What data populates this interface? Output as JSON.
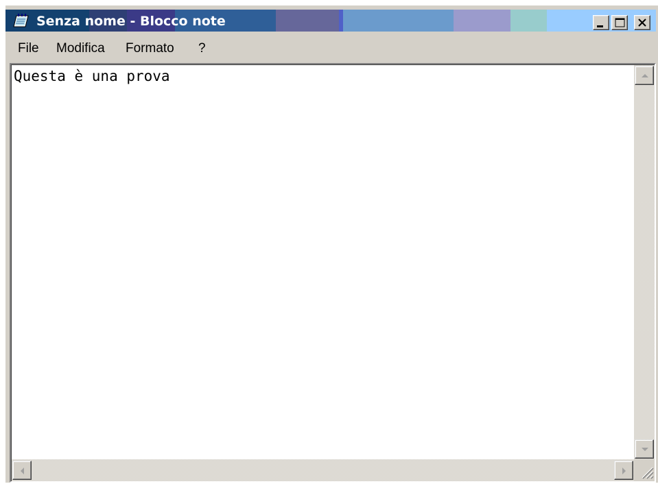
{
  "window": {
    "title": "Senza nome - Blocco note",
    "icon": "notepad-icon",
    "caption_buttons": [
      "minimize-icon",
      "maximize-icon",
      "close-icon"
    ]
  },
  "menu": {
    "items": [
      {
        "label": "File"
      },
      {
        "label": "Modifica"
      },
      {
        "label": "Formato"
      },
      {
        "label": "?"
      }
    ]
  },
  "editor": {
    "content": "Questa è una prova"
  },
  "scrollbars": {
    "vertical": [
      "scroll-up-arrow-icon",
      "scroll-down-arrow-icon"
    ],
    "horizontal": [
      "scroll-left-arrow-icon",
      "scroll-right-arrow-icon"
    ]
  },
  "colors": {
    "title_gradient": [
      "#0a246a",
      "#3a6ea5",
      "#a6caf0"
    ],
    "face": "#d4d0c8"
  }
}
